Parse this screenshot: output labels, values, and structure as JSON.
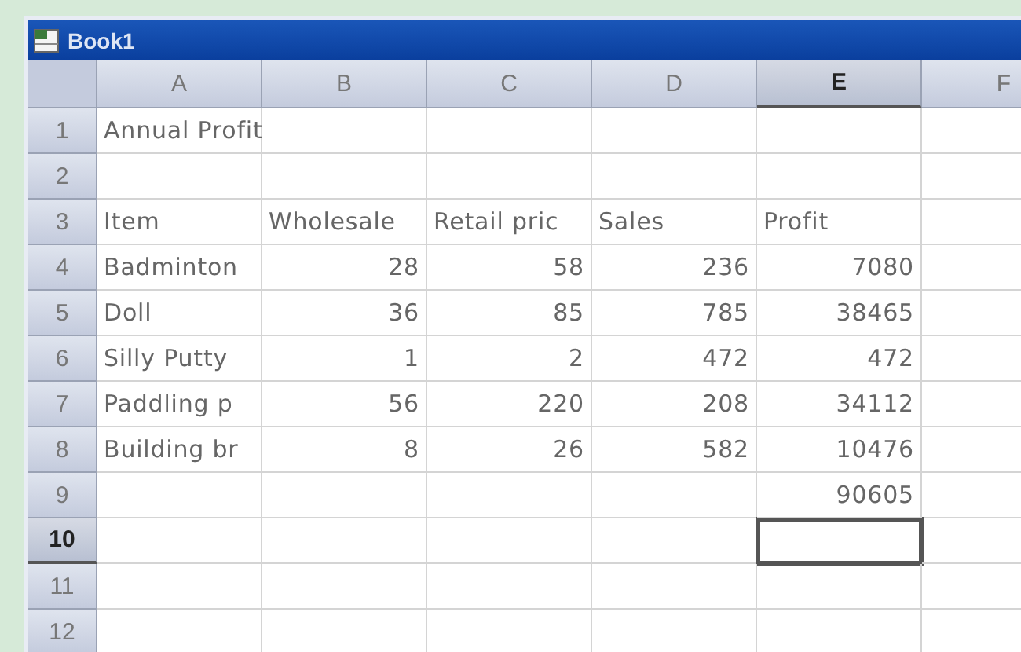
{
  "window": {
    "title": "Book1"
  },
  "columns": [
    {
      "label": "A",
      "selected": false
    },
    {
      "label": "B",
      "selected": false
    },
    {
      "label": "C",
      "selected": false
    },
    {
      "label": "D",
      "selected": false
    },
    {
      "label": "E",
      "selected": true
    },
    {
      "label": "F",
      "selected": false
    }
  ],
  "rows": [
    {
      "label": "1",
      "selected": false,
      "kind": "text",
      "cells": [
        "Annual Profit",
        null,
        null,
        null,
        null,
        null
      ]
    },
    {
      "label": "2",
      "selected": false,
      "kind": "text",
      "cells": [
        null,
        null,
        null,
        null,
        null,
        null
      ]
    },
    {
      "label": "3",
      "selected": false,
      "kind": "text",
      "cells": [
        "Item",
        "Wholesale",
        "Retail pric",
        "Sales",
        "Profit",
        null
      ]
    },
    {
      "label": "4",
      "selected": false,
      "kind": "data",
      "cells": [
        "Badminton",
        "28",
        "58",
        "236",
        "7080",
        null
      ]
    },
    {
      "label": "5",
      "selected": false,
      "kind": "data",
      "cells": [
        "Doll",
        "36",
        "85",
        "785",
        "38465",
        null
      ]
    },
    {
      "label": "6",
      "selected": false,
      "kind": "data",
      "cells": [
        "Silly Putty",
        "1",
        "2",
        "472",
        "472",
        null
      ]
    },
    {
      "label": "7",
      "selected": false,
      "kind": "data",
      "cells": [
        "Paddling p",
        "56",
        "220",
        "208",
        "34112",
        null
      ]
    },
    {
      "label": "8",
      "selected": false,
      "kind": "data",
      "cells": [
        "Building br",
        "8",
        "26",
        "582",
        "10476",
        null
      ]
    },
    {
      "label": "9",
      "selected": false,
      "kind": "data",
      "cells": [
        null,
        null,
        null,
        null,
        "90605",
        null
      ]
    },
    {
      "label": "10",
      "selected": true,
      "kind": "data",
      "cells": [
        null,
        null,
        null,
        null,
        null,
        null
      ]
    },
    {
      "label": "11",
      "selected": false,
      "kind": "data",
      "cells": [
        null,
        null,
        null,
        null,
        null,
        null
      ]
    },
    {
      "label": "12",
      "selected": false,
      "kind": "data",
      "cells": [
        null,
        null,
        null,
        null,
        null,
        null
      ]
    }
  ]
}
